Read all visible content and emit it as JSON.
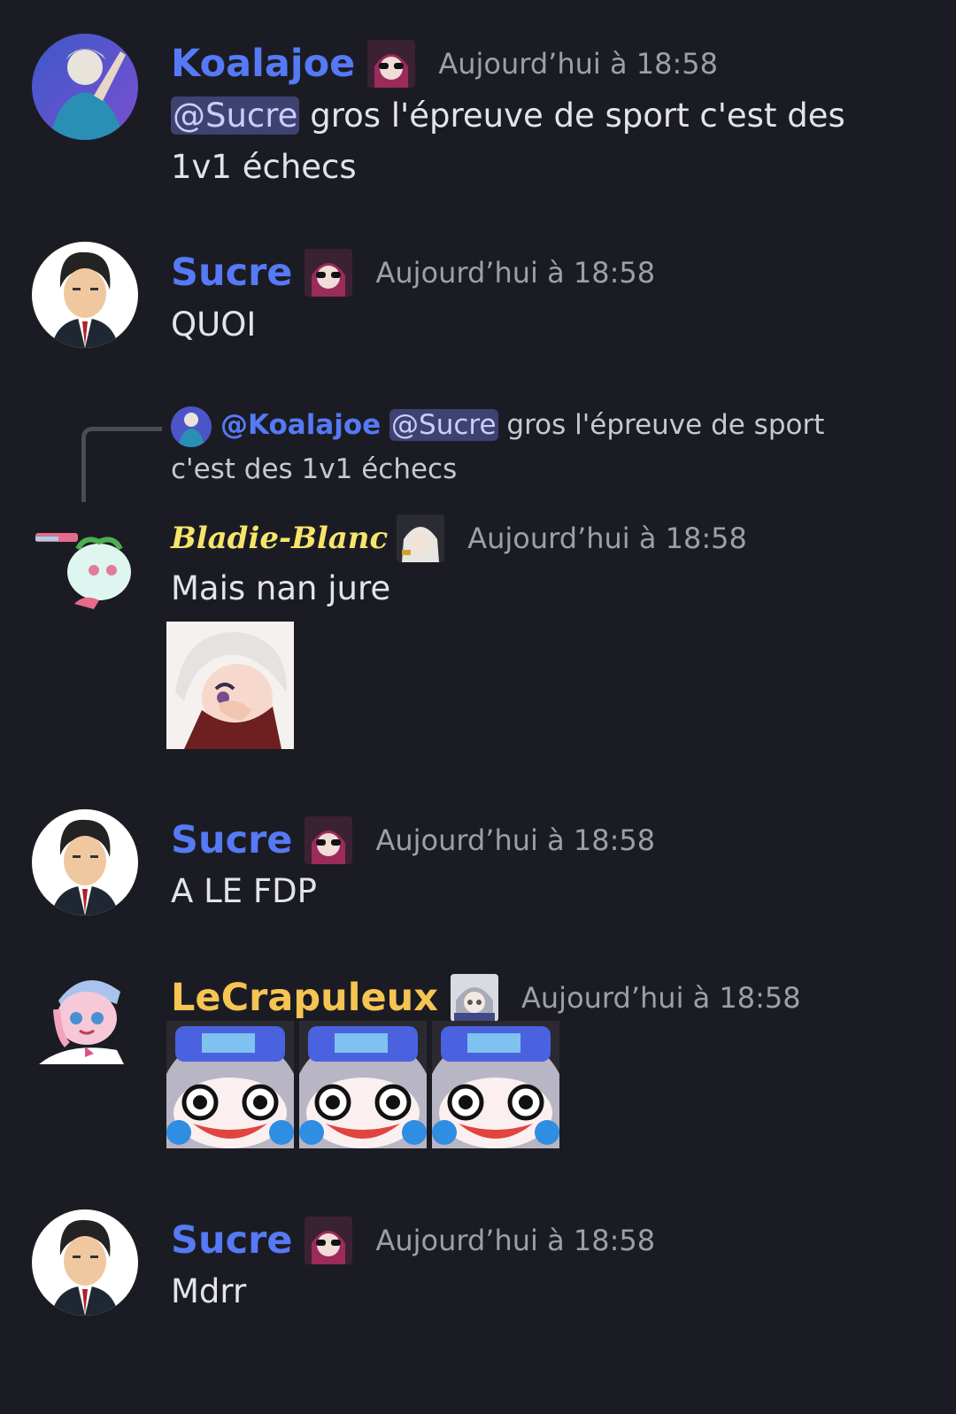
{
  "messages": [
    {
      "username": "Koalajoe",
      "timestamp": "Aujourd’hui à 18:58",
      "mention": "@Sucre",
      "text": " gros l'épreuve de sport c'est des 1v1 échecs"
    },
    {
      "username": "Sucre",
      "timestamp": "Aujourd’hui à 18:58",
      "text": "QUOI"
    },
    {
      "reply": {
        "author": "@Koalajoe",
        "mention": "@Sucre",
        "text": " gros l'épreuve de sport c'est des 1v1 échecs"
      },
      "username": "Bladie-Blanc",
      "timestamp": "Aujourd’hui à 18:58",
      "text": "Mais nan jure"
    },
    {
      "username": "Sucre",
      "timestamp": "Aujourd’hui à 18:58",
      "text": "A LE FDP"
    },
    {
      "username": "LeCrapuleux",
      "timestamp": "Aujourd’hui à 18:58"
    },
    {
      "username": "Sucre",
      "timestamp": "Aujourd’hui à 18:58",
      "text": "Mdrr"
    }
  ],
  "colors": {
    "background": "#1b1c23",
    "username_blue": "#5679f5",
    "username_gold": "#f6c452",
    "username_yellow_script": "#f7e56b",
    "mention_bg": "#3d4270",
    "timestamp": "#9d9fa8"
  }
}
